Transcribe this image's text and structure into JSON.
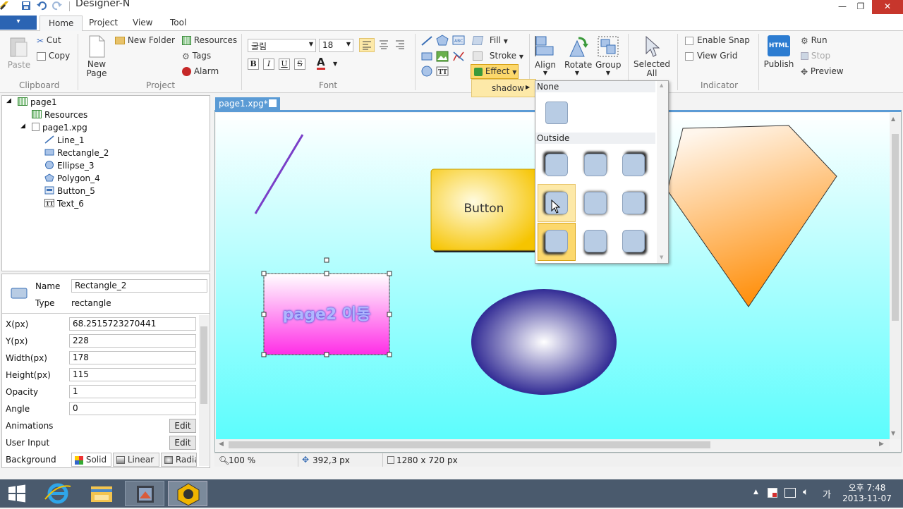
{
  "window": {
    "title": "Designer-N",
    "minimize_glyph": "—",
    "maximize_glyph": "❐",
    "close_glyph": "✕"
  },
  "ribbon_tabs": [
    "Home",
    "Project",
    "View",
    "Tool"
  ],
  "active_tab": "Home",
  "app_menu_glyph": "▾",
  "ribbon": {
    "clipboard": {
      "label": "Clipboard",
      "paste": "Paste",
      "cut": "Cut",
      "copy": "Copy"
    },
    "project": {
      "label": "Project",
      "new_page": "New\nPage",
      "new_folder": "New Folder",
      "resources": "Resources",
      "tags": "Tags",
      "alarm": "Alarm"
    },
    "font": {
      "label": "Font",
      "family": "굴림",
      "size": "18",
      "bold": "B",
      "italic": "I",
      "underline": "U",
      "strike": "S",
      "color_glyph": "A"
    },
    "shape": {
      "fill": "Fill",
      "stroke": "Stroke",
      "effect": "Effect",
      "align": "Align",
      "rotate": "Rotate",
      "group": "Group",
      "selected_all": "Selected\nAll"
    },
    "indicator": {
      "label": "Indicator",
      "enable_snap": "Enable Snap",
      "view_grid": "View Grid"
    },
    "run": {
      "publish": "Publish",
      "run": "Run",
      "stop": "Stop",
      "preview": "Preview",
      "html_badge": "HTML"
    }
  },
  "tree": {
    "items": [
      {
        "label": "page1",
        "icon": "page-grid-icon"
      },
      {
        "label": "Resources",
        "icon": "resources-icon"
      },
      {
        "label": "page1.xpg",
        "icon": "page-file-icon"
      },
      {
        "label": "Line_1",
        "icon": "line-icon"
      },
      {
        "label": "Rectangle_2",
        "icon": "rectangle-icon"
      },
      {
        "label": "Ellipse_3",
        "icon": "ellipse-icon"
      },
      {
        "label": "Polygon_4",
        "icon": "polygon-icon"
      },
      {
        "label": "Button_5",
        "icon": "button-icon"
      },
      {
        "label": "Text_6",
        "icon": "text-icon"
      }
    ]
  },
  "properties": {
    "name_label": "Name",
    "name_value": "Rectangle_2",
    "type_label": "Type",
    "type_value": "rectangle",
    "fields": [
      {
        "label": "X(px)",
        "value": "68.2515723270441"
      },
      {
        "label": "Y(px)",
        "value": "228"
      },
      {
        "label": "Width(px)",
        "value": "178"
      },
      {
        "label": "Height(px)",
        "value": "115"
      },
      {
        "label": "Opacity",
        "value": "1"
      },
      {
        "label": "Angle",
        "value": "0"
      }
    ],
    "animations_label": "Animations",
    "user_input_label": "User Input",
    "edit_label": "Edit",
    "background_label": "Background",
    "bg_solid": "Solid",
    "bg_linear": "Linear",
    "bg_radial": "Radia"
  },
  "document_tab": "page1.xpg*",
  "canvas": {
    "button_text": "Button",
    "rect_text": "page2 이동"
  },
  "effect_menu": {
    "shadow_label": "shadow",
    "none_label": "None",
    "outside_label": "Outside"
  },
  "status": {
    "zoom": "100 %",
    "position": "392,3 px",
    "size": "1280 x 720 px"
  },
  "tray": {
    "ime": "가",
    "time": "오후 7:48",
    "date": "2013-11-07"
  },
  "colors": {
    "accent": "#5b9bd5",
    "app_menu": "#2b64b3",
    "close_button": "#c7362c",
    "taskbar": "#4a5a6d",
    "effect_highlight": "#fde9a8"
  }
}
